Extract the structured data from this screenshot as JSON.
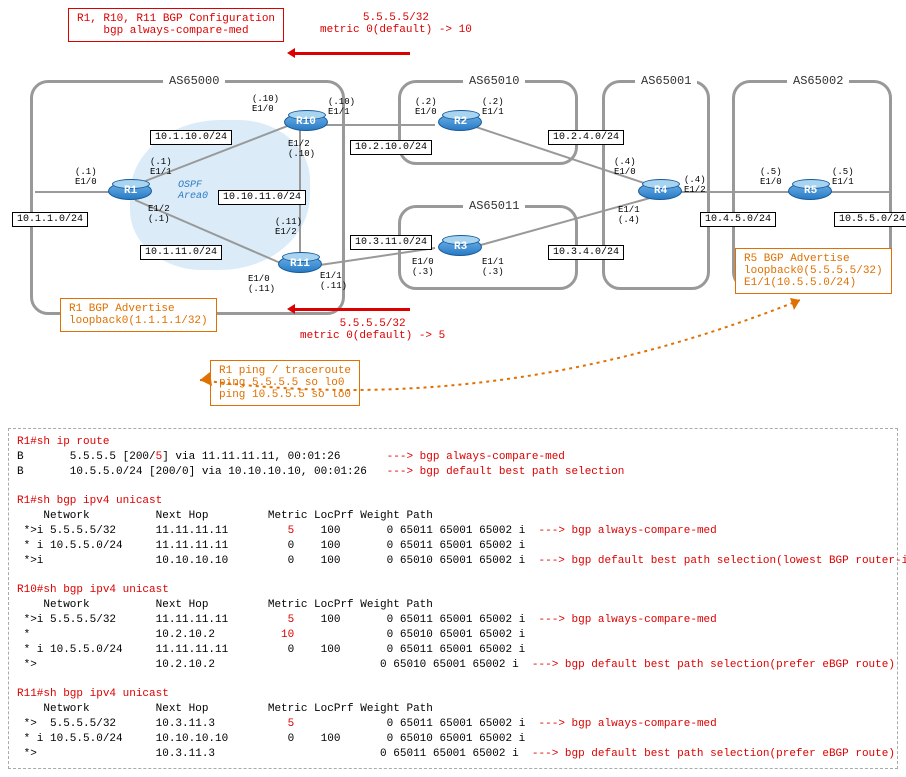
{
  "notes": {
    "topleft_l1": "R1, R10, R11 BGP Configuration",
    "topleft_l2": "bgp always-compare-med",
    "metric10_l1": "5.5.5.5/32",
    "metric10_l2": "metric 0(default) -> 10",
    "metric5_l1": "5.5.5.5/32",
    "metric5_l2": "metric 0(default) -> 5",
    "r1adv_l1": "R1 BGP Advertise",
    "r1adv_l2": "loopback0(1.1.1.1/32)",
    "r5adv_l1": "R5 BGP Advertise",
    "r5adv_l2": "loopback0(5.5.5.5/32)",
    "r5adv_l3": "E1/1(10.5.5.0/24)",
    "ping_l1": "R1 ping / traceroute",
    "ping_l2": "ping 5.5.5.5 so lo0",
    "ping_l3": "ping 10.5.5.5 so lo0"
  },
  "as": {
    "as65000": "AS65000",
    "as65010": "AS65010",
    "as65011": "AS65011",
    "as65001": "AS65001",
    "as65002": "AS65002"
  },
  "routers": {
    "r1": "R1",
    "r2": "R2",
    "r3": "R3",
    "r4": "R4",
    "r5": "R5",
    "r10": "R10",
    "r11": "R11"
  },
  "subnets": {
    "s1": "10.1.1.0/24",
    "s2": "10.1.10.0/24",
    "s3": "10.1.11.0/24",
    "s4": "10.10.11.0/24",
    "s5": "10.2.10.0/24",
    "s6": "10.3.11.0/24",
    "s7": "10.2.4.0/24",
    "s8": "10.3.4.0/24",
    "s9": "10.4.5.0/24",
    "s10": "10.5.5.0/24"
  },
  "ifaces": {
    "r1_e10": "(.1)\nE1/0",
    "r1_e11": "(.1)\nE1/1",
    "r1_e12": "E1/2\n(.1)",
    "r10_e10_l": "(.10)\nE1/0",
    "r10_e12": "E1/2\n(.10)",
    "r10_e11": "(.10)\nE1/1",
    "r11_e10_l": "E1/0\n(.11)",
    "r11_e12": "(.11)\nE1/2",
    "r11_e11": "E1/1\n(.11)",
    "r2_e10": "(.2)\nE1/0",
    "r2_e11": "(.2)\nE1/1",
    "r3_e10": "E1/0\n(.3)",
    "r3_e11": "E1/1\n(.3)",
    "r4_e10": "(.4)\nE1/0",
    "r4_e11": "E1/1\n(.4)",
    "r4_e12": "(.4)\nE1/2",
    "r5_e10": "(.5)\nE1/0",
    "r5_e11": "(.5)\nE1/1"
  },
  "ospf": "OSPF\nArea0",
  "terminal": {
    "r1_route_cmd": "R1#sh ip route",
    "r1_route_1a": "B       5.5.5.5 [200/",
    "r1_route_1met": "5",
    "r1_route_1b": "] via 11.11.11.11, 00:01:26       ",
    "r1_route_1ann": "---> bgp always-compare-med",
    "r1_route_2a": "B       10.5.5.0/24 [200/0] via 10.10.10.10, 00:01:26   ",
    "r1_route_2ann": "---> bgp default best path selection",
    "r1_bgp_cmd": "R1#sh bgp ipv4 unicast",
    "hdr": "    Network          Next Hop         Metric LocPrf Weight Path",
    "r1_b1a": " *>i 5.5.5.5/32      11.11.11.11         ",
    "r1_b1m": "5",
    "r1_b1b": "    100       0 65011 65001 65002 i  ",
    "ann_med": "---> bgp always-compare-med",
    "r1_b2": " * i 10.5.5.0/24     11.11.11.11         0    100       0 65011 65001 65002 i",
    "r1_b3a": " *>i                 10.10.10.10         0    100       0 65010 65001 65002 i  ",
    "ann_rid": "---> bgp default best path selection(lowest BGP router-id)",
    "r10_bgp_cmd": "R10#sh bgp ipv4 unicast",
    "r10_b1a": " *>i 5.5.5.5/32      11.11.11.11         ",
    "r10_b1m": "5",
    "r10_b1b": "    100       0 65011 65001 65002 i  ",
    "r10_b2a": " *                   10.2.10.2          ",
    "r10_b2m": "10",
    "r10_b2b": "              0 65010 65001 65002 i",
    "r10_b3": " * i 10.5.5.0/24     11.11.11.11         0    100       0 65011 65001 65002 i",
    "r10_b4a": " *>                  10.2.10.2                         0 65010 65001 65002 i  ",
    "ann_ebgp": "---> bgp default best path selection(prefer eBGP route)",
    "r11_bgp_cmd": "R11#sh bgp ipv4 unicast",
    "r11_b1a": " *>  5.5.5.5/32      10.3.11.3           ",
    "r11_b1m": "5",
    "r11_b1b": "              0 65011 65001 65002 i  ",
    "r11_b2": " * i 10.5.5.0/24     10.10.10.10         0    100       0 65010 65001 65002 i",
    "r11_b3a": " *>                  10.3.11.3                         0 65011 65001 65002 i  "
  }
}
